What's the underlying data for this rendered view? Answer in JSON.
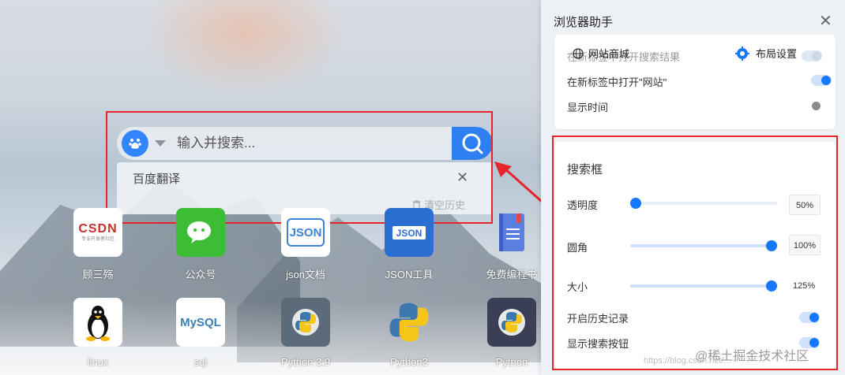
{
  "search": {
    "placeholder": "输入并搜索...",
    "history_item": "百度翻译",
    "clear_history": "清空历史"
  },
  "apps": [
    {
      "label": "顾三殇",
      "icon": "csdn-logo"
    },
    {
      "label": "公众号",
      "icon": "wechat-icon"
    },
    {
      "label": "json文档",
      "icon": "json-doc-icon"
    },
    {
      "label": "JSON工具",
      "icon": "json-tool-icon"
    },
    {
      "label": "免费编程书",
      "icon": "book-icon"
    },
    {
      "label": "linux",
      "icon": "linux-penguin-icon"
    },
    {
      "label": "sql",
      "icon": "mysql-icon"
    },
    {
      "label": "Python 3.9",
      "icon": "python-icon"
    },
    {
      "label": "Python3",
      "icon": "python-icon"
    },
    {
      "label": "Python",
      "icon": "python-icon"
    }
  ],
  "csdn_logo_text": "CSDN",
  "csdn_logo_sub": "专业开发者社区",
  "json_label": "JSON",
  "mysql_text": "MySQL",
  "panel": {
    "title": "浏览器助手",
    "tab_store": "网站商城",
    "tab_layout": "布局设置",
    "general": {
      "row1": "在新标签中打开搜索结果",
      "row2": "在新标签中打开\"网站\"",
      "row3": "显示时间"
    },
    "searchbox": {
      "heading": "搜索框",
      "opacity_label": "透明度",
      "opacity_value": "50%",
      "radius_label": "圆角",
      "radius_value": "100%",
      "size_label": "大小",
      "size_value": "125%",
      "history_label": "开启历史记录",
      "button_label": "显示搜索按钮"
    }
  },
  "sliders": {
    "opacity": 0.0,
    "radius": 1.0,
    "size": 1.0
  },
  "watermark": "@稀土掘金技术社区",
  "watermark_url": "https://blog.csdn.net/..."
}
